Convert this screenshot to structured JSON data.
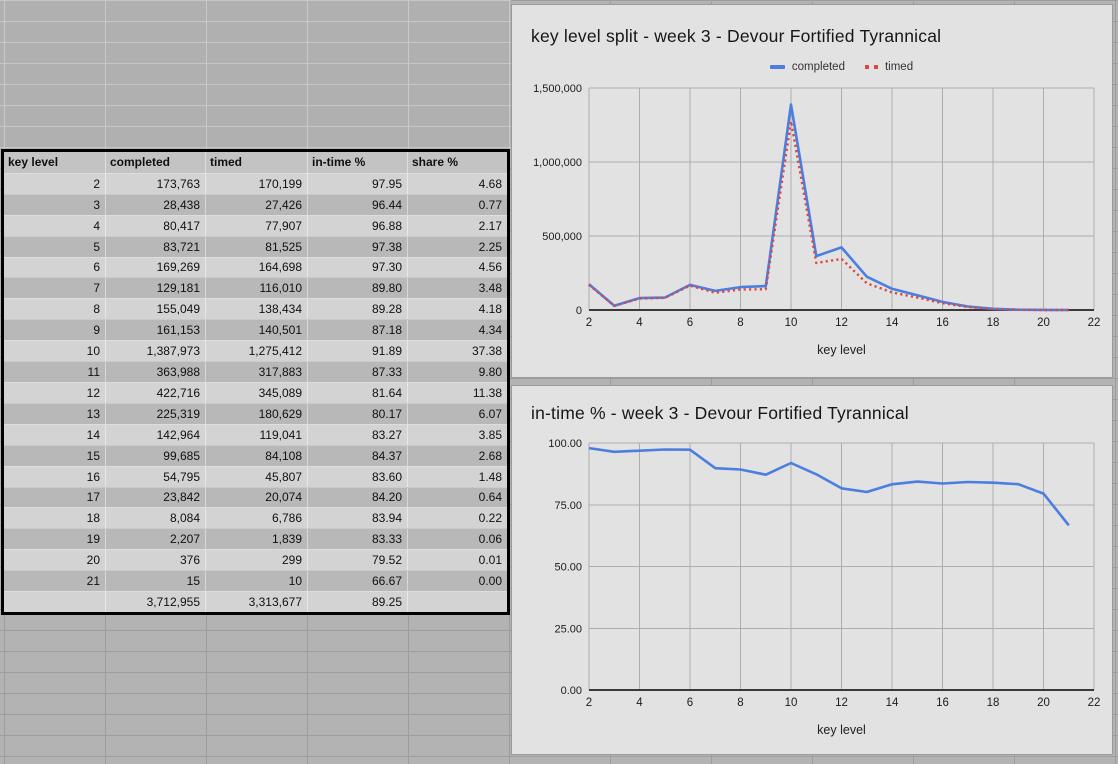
{
  "sheet": {
    "table": {
      "headers": [
        "key level",
        "completed",
        "timed",
        "in-time %",
        "share %"
      ],
      "rows": [
        [
          "2",
          "173,763",
          "170,199",
          "97.95",
          "4.68"
        ],
        [
          "3",
          "28,438",
          "27,426",
          "96.44",
          "0.77"
        ],
        [
          "4",
          "80,417",
          "77,907",
          "96.88",
          "2.17"
        ],
        [
          "5",
          "83,721",
          "81,525",
          "97.38",
          "2.25"
        ],
        [
          "6",
          "169,269",
          "164,698",
          "97.30",
          "4.56"
        ],
        [
          "7",
          "129,181",
          "116,010",
          "89.80",
          "3.48"
        ],
        [
          "8",
          "155,049",
          "138,434",
          "89.28",
          "4.18"
        ],
        [
          "9",
          "161,153",
          "140,501",
          "87.18",
          "4.34"
        ],
        [
          "10",
          "1,387,973",
          "1,275,412",
          "91.89",
          "37.38"
        ],
        [
          "11",
          "363,988",
          "317,883",
          "87.33",
          "9.80"
        ],
        [
          "12",
          "422,716",
          "345,089",
          "81.64",
          "11.38"
        ],
        [
          "13",
          "225,319",
          "180,629",
          "80.17",
          "6.07"
        ],
        [
          "14",
          "142,964",
          "119,041",
          "83.27",
          "3.85"
        ],
        [
          "15",
          "99,685",
          "84,108",
          "84.37",
          "2.68"
        ],
        [
          "16",
          "54,795",
          "45,807",
          "83.60",
          "1.48"
        ],
        [
          "17",
          "23,842",
          "20,074",
          "84.20",
          "0.64"
        ],
        [
          "18",
          "8,084",
          "6,786",
          "83.94",
          "0.22"
        ],
        [
          "19",
          "2,207",
          "1,839",
          "83.33",
          "0.06"
        ],
        [
          "20",
          "376",
          "299",
          "79.52",
          "0.01"
        ],
        [
          "21",
          "15",
          "10",
          "66.67",
          "0.00"
        ]
      ],
      "total_row": [
        "",
        "3,712,955",
        "3,313,677",
        "89.25",
        ""
      ]
    }
  },
  "colors": {
    "series_blue": "#4b7ee0",
    "series_red": "#d9493f",
    "chart_grid": "#adadad",
    "chart_axis": "#3a3a3a",
    "panel_bg": "#e2e2e2"
  },
  "chart_data": [
    {
      "type": "line",
      "title": "key level split - week 3 - Devour Fortified Tyrannical",
      "xlabel": "key level",
      "ylabel": "",
      "legend_position": "top",
      "grid": true,
      "xlim": [
        2,
        22
      ],
      "ylim": [
        0,
        1500000
      ],
      "xticks": [
        2,
        4,
        6,
        8,
        10,
        12,
        14,
        16,
        18,
        20,
        22
      ],
      "yticks": [
        {
          "v": 0,
          "label": "0"
        },
        {
          "v": 500000,
          "label": "500,000"
        },
        {
          "v": 1000000,
          "label": "1,000,000"
        },
        {
          "v": 1500000,
          "label": "1,500,000"
        }
      ],
      "x": [
        2,
        3,
        4,
        5,
        6,
        7,
        8,
        9,
        10,
        11,
        12,
        13,
        14,
        15,
        16,
        17,
        18,
        19,
        20,
        21
      ],
      "series": [
        {
          "name": "completed",
          "color": "#4b7ee0",
          "style": "solid",
          "values": [
            173763,
            28438,
            80417,
            83721,
            169269,
            129181,
            155049,
            161153,
            1387973,
            363988,
            422716,
            225319,
            142964,
            99685,
            54795,
            23842,
            8084,
            2207,
            376,
            15
          ]
        },
        {
          "name": "timed",
          "color": "#d9493f",
          "style": "dotted",
          "values": [
            170199,
            27426,
            77907,
            81525,
            164698,
            116010,
            138434,
            140501,
            1275412,
            317883,
            345089,
            180629,
            119041,
            84108,
            45807,
            20074,
            6786,
            1839,
            299,
            10
          ]
        }
      ]
    },
    {
      "type": "line",
      "title": "in-time % - week 3 - Devour Fortified Tyrannical",
      "xlabel": "key level",
      "ylabel": "",
      "legend_position": "none",
      "grid": true,
      "xlim": [
        2,
        22
      ],
      "ylim": [
        0,
        100
      ],
      "xticks": [
        2,
        4,
        6,
        8,
        10,
        12,
        14,
        16,
        18,
        20,
        22
      ],
      "yticks": [
        {
          "v": 0,
          "label": "0.00"
        },
        {
          "v": 25,
          "label": "25.00"
        },
        {
          "v": 50,
          "label": "50.00"
        },
        {
          "v": 75,
          "label": "75.00"
        },
        {
          "v": 100,
          "label": "100.00"
        }
      ],
      "x": [
        2,
        3,
        4,
        5,
        6,
        7,
        8,
        9,
        10,
        11,
        12,
        13,
        14,
        15,
        16,
        17,
        18,
        19,
        20,
        21
      ],
      "series": [
        {
          "name": "in-time %",
          "color": "#4b7ee0",
          "style": "solid",
          "values": [
            97.95,
            96.44,
            96.88,
            97.38,
            97.3,
            89.8,
            89.28,
            87.18,
            91.89,
            87.33,
            81.64,
            80.17,
            83.27,
            84.37,
            83.6,
            84.2,
            83.94,
            83.33,
            79.52,
            66.67
          ]
        }
      ]
    }
  ]
}
